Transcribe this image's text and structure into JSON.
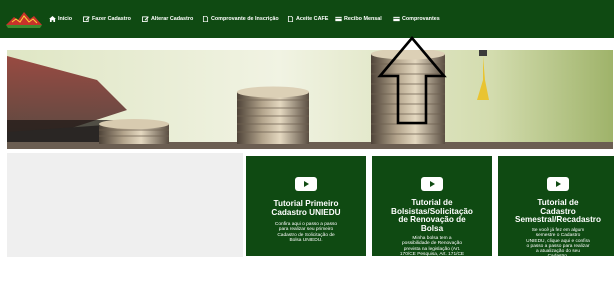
{
  "nav": {
    "items": [
      {
        "label": "Início",
        "icon": "home-icon"
      },
      {
        "label": "Fazer Cadastro",
        "icon": "edit-icon"
      },
      {
        "label": "Alterar Cadastro",
        "icon": "edit-icon"
      },
      {
        "label": "Comprovante de Inscrição",
        "icon": "document-icon"
      },
      {
        "label": "Aceite CAFE",
        "icon": "document-icon"
      },
      {
        "label": "Recibo Mensal",
        "icon": "card-icon"
      },
      {
        "label": "Comprovantes",
        "icon": "card-icon"
      }
    ]
  },
  "cards": [
    {
      "title": "Tutorial Primeiro\nCadastro UNIEDU",
      "description": "Confira aqui o passo a passo\npara realizar seu primeiro\nCadastro de Solicitação de\nBolsa UNIEDU."
    },
    {
      "title": "Tutorial de\nBolsistas/Solicitação\nde Renovação de\nBolsa",
      "description": "Minha bolsa tem a\npossibilidade de Renovação\nprevista na legislação (Art.\n170/CE Pesquisa, Art. 171/CE\nPesquisa, Estudo e\nLicenciatura), como devo\nproceder?"
    },
    {
      "title": "Tutorial de\nCadastro\nSemestral/Recadastro",
      "description": "Se você já fez em algum\nsemestre o Cadastro\nUNIEDU, clique aqui e confira\no passo a passo para realizar\na atualização do seu\nCadastro."
    }
  ],
  "colors": {
    "brand_green": "#0f4a12",
    "white": "#ffffff",
    "panel_gray": "#efefef"
  }
}
